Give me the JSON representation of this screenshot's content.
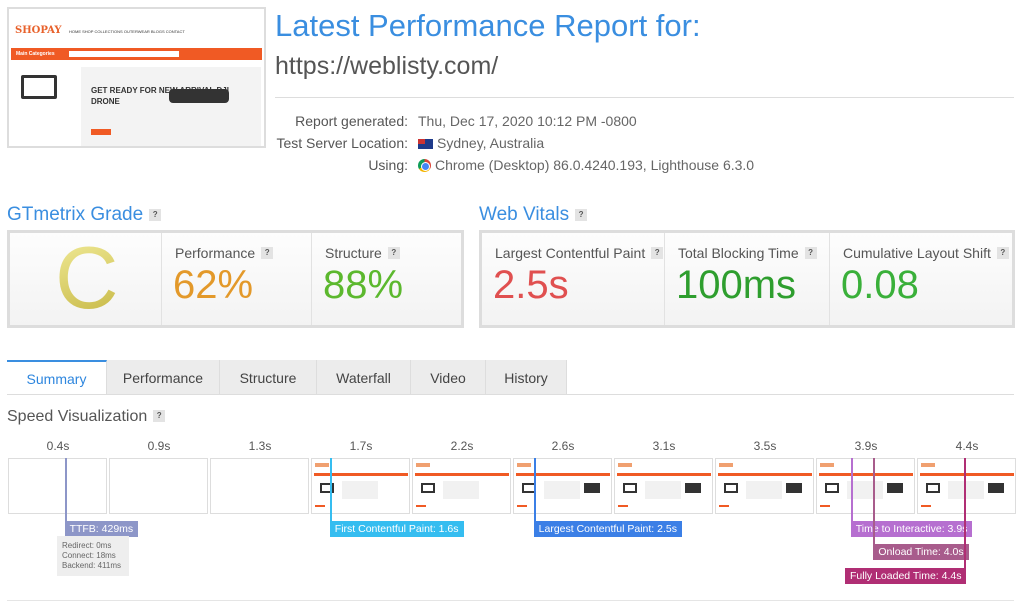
{
  "thumbnail": {
    "site_name": "SHOPAY",
    "category_bar": "Main Categories",
    "hero_text": "GET READY FOR NEW ARRIVAL DJI DRONE",
    "nav": "HOME SHOP COLLECTIONS OUTERWEAR BLOGS CONTACT"
  },
  "header": {
    "title": "Latest Performance Report for:",
    "url": "https://weblisty.com/"
  },
  "meta": [
    {
      "label": "Report generated:",
      "value": "Thu, Dec 17, 2020 10:12 PM -0800"
    },
    {
      "label": "Test Server Location:",
      "value": "Sydney, Australia",
      "icon": "australia-flag-icon"
    },
    {
      "label": "Using:",
      "value": "Chrome (Desktop) 86.0.4240.193, Lighthouse 6.3.0",
      "icon": "chrome-icon"
    }
  ],
  "grade": {
    "heading": "GTmetrix Grade",
    "help": "?",
    "letter": "C",
    "performance_label": "Performance",
    "performance": "62%",
    "structure_label": "Structure",
    "structure": "88%"
  },
  "vitals": {
    "heading": "Web Vitals",
    "help": "?",
    "lcp_label": "Largest Contentful Paint",
    "lcp": "2.5s",
    "tbt_label": "Total Blocking Time",
    "tbt": "100ms",
    "cls_label": "Cumulative Layout Shift",
    "cls": "0.08"
  },
  "colors": {
    "accent": "#3a8ee0",
    "performance": "#e3992a",
    "good": "#5cb82e",
    "bad": "#e05050",
    "tbt": "#2e9e2e",
    "cls": "#3ab03a"
  },
  "tabs": [
    {
      "label": "Summary",
      "active": true
    },
    {
      "label": "Performance"
    },
    {
      "label": "Structure"
    },
    {
      "label": "Waterfall"
    },
    {
      "label": "Video"
    },
    {
      "label": "History"
    }
  ],
  "speed": {
    "heading": "Speed Visualization",
    "help": "?",
    "frame_times": [
      "0.4s",
      "0.9s",
      "1.3s",
      "1.7s",
      "2.2s",
      "2.6s",
      "3.1s",
      "3.5s",
      "3.9s",
      "4.4s"
    ],
    "frame_seconds": [
      0.4,
      0.9,
      1.3,
      1.7,
      2.2,
      2.6,
      3.1,
      3.5,
      3.9,
      4.4
    ],
    "frames_blank": [
      true,
      true,
      true,
      false,
      false,
      false,
      false,
      false,
      false,
      false
    ],
    "markers": [
      {
        "label": "TTFB: 429ms",
        "seconds": 0.429,
        "color": "#8d96c8",
        "row": 0
      },
      {
        "label": "First Contentful Paint: 1.6s",
        "seconds": 1.6,
        "color": "#35bdf0",
        "row": 0
      },
      {
        "label": "Largest Contentful Paint: 2.5s",
        "seconds": 2.5,
        "color": "#3b7fe6",
        "row": 0
      },
      {
        "label": "Time to Interactive: 3.9s",
        "seconds": 3.9,
        "color": "#b66fd0",
        "row": 0
      },
      {
        "label": "Onload Time: 4.0s",
        "seconds": 4.0,
        "color": "#a85c8c",
        "row": 1
      },
      {
        "label": "Fully Loaded Time: 4.4s",
        "seconds": 4.4,
        "color": "#b02e74",
        "row": 2
      }
    ],
    "ttfb_details": [
      "Redirect: 0ms",
      "Connect: 18ms",
      "Backend: 411ms"
    ]
  }
}
